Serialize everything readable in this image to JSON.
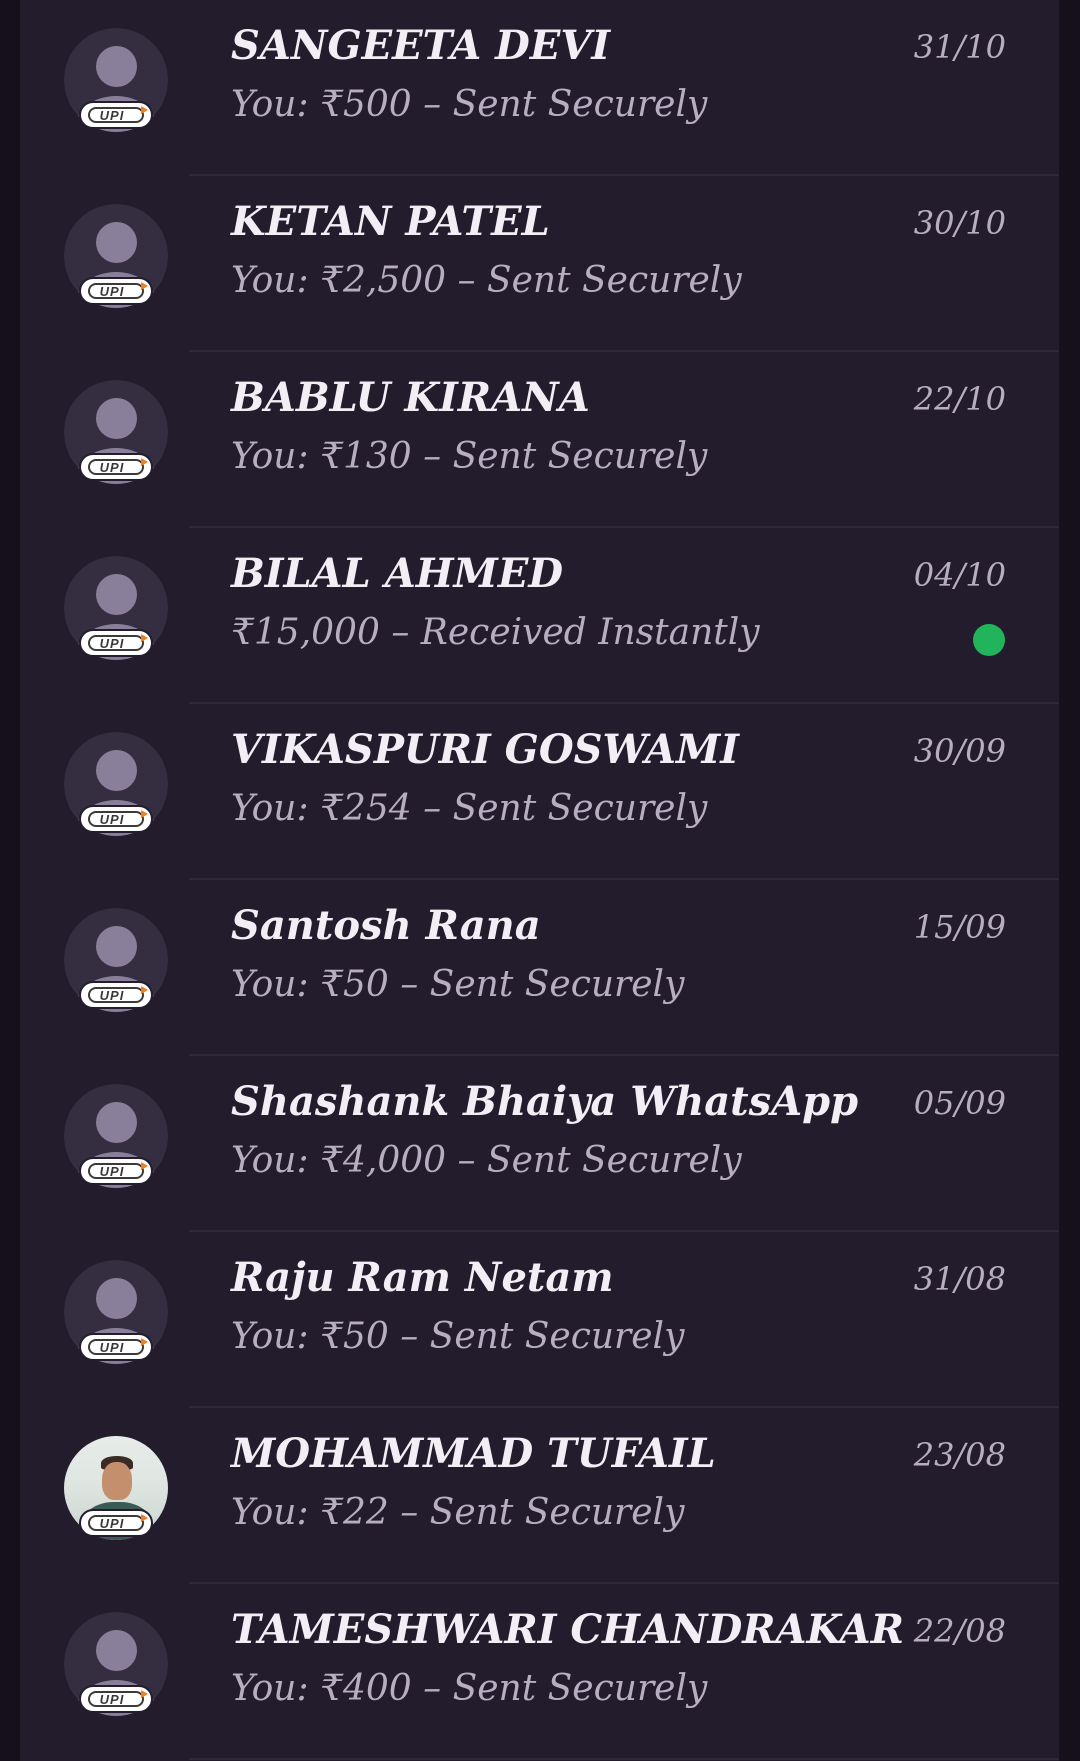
{
  "upi_badge_label": "UPI",
  "colors": {
    "background": "#15101c",
    "panel": "#221c2c",
    "name_text": "#f2eef5",
    "secondary_text": "#b7aec2",
    "unread_dot": "#21b45b",
    "upi_arrow": "#f47b20"
  },
  "transactions": [
    {
      "name": "SANGEETA DEVI",
      "subtitle": "You: ₹500 – Sent Securely",
      "date": "31/10",
      "avatar": "default-person-icon",
      "unread": false
    },
    {
      "name": "KETAN PATEL",
      "subtitle": "You: ₹2,500 – Sent Securely",
      "date": "30/10",
      "avatar": "default-person-icon",
      "unread": false
    },
    {
      "name": "BABLU KIRANA",
      "subtitle": "You: ₹130 – Sent Securely",
      "date": "22/10",
      "avatar": "default-person-icon",
      "unread": false
    },
    {
      "name": "BILAL AHMED",
      "subtitle": "₹15,000 – Received Instantly",
      "date": "04/10",
      "avatar": "default-person-icon",
      "unread": true
    },
    {
      "name": "VIKASPURI GOSWAMI",
      "subtitle": "You: ₹254 – Sent Securely",
      "date": "30/09",
      "avatar": "default-person-icon",
      "unread": false
    },
    {
      "name": "Santosh Rana",
      "subtitle": "You: ₹50 – Sent Securely",
      "date": "15/09",
      "avatar": "default-person-icon",
      "unread": false
    },
    {
      "name": "Shashank Bhaiya WhatsApp",
      "subtitle": "You: ₹4,000 – Sent Securely",
      "date": "05/09",
      "avatar": "default-person-icon",
      "unread": false
    },
    {
      "name": "Raju Ram Netam",
      "subtitle": "You: ₹50 – Sent Securely",
      "date": "31/08",
      "avatar": "default-person-icon",
      "unread": false
    },
    {
      "name": "MOHAMMAD TUFAIL",
      "subtitle": "You: ₹22 – Sent Securely",
      "date": "23/08",
      "avatar": "profile-photo",
      "unread": false
    },
    {
      "name": "TAMESHWARI CHANDRAKAR",
      "subtitle": "You: ₹400 – Sent Securely",
      "date": "22/08",
      "avatar": "default-person-icon",
      "unread": false
    }
  ]
}
